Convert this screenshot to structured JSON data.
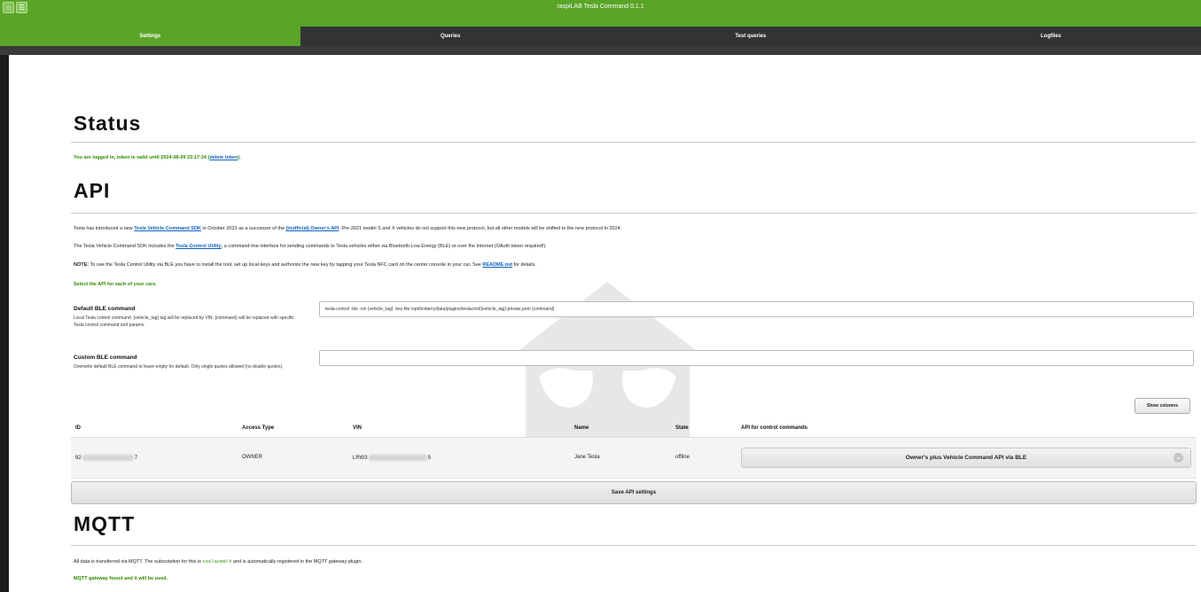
{
  "app": {
    "title": "raspiLAB Tesla Command 0.1.1",
    "home_icon": "⌂",
    "menu_icon": "☰"
  },
  "tabs": [
    {
      "label": "Settings",
      "active": true
    },
    {
      "label": "Queries",
      "active": false
    },
    {
      "label": "Test queries",
      "active": false
    },
    {
      "label": "Logfiles",
      "active": false
    }
  ],
  "status": {
    "heading": "Status",
    "message_prefix": "You are logged in, token is valid until 2024-08-09 23:17:24 (",
    "delete_link": "delete token",
    "message_suffix": ")."
  },
  "api": {
    "heading": "API",
    "p1_a": "Tesla has introduced a new ",
    "p1_link1": "Tesla Vehicle Command SDK",
    "p1_b": " in October 2023 as a successor of the ",
    "p1_link2": "(inofficial) Owner's API",
    "p1_c": ". Pre-2021 model S and X vehicles do not support this new protocol, but all other models will be shifted to the new protocol in 2024.",
    "p2_a": "The Tesla Vehicle Command SDK includes the ",
    "p2_link": "Tesla Control Utility",
    "p2_b": ", a command-line interface for sending commands to Tesla vehicles either via Bluetooth Low Energy (BLE) or over the Internet (OAuth token required!).",
    "p3_note": "NOTE:",
    "p3_a": " To use the Tesla Control Utility via BLE you have to install the tool, set up local keys and authorize the new key by tapping your Tesla NFC card on the center console in your car. See ",
    "p3_link": "README.md",
    "p3_b": " for details.",
    "select_prompt": "Select the API for each of your cars.",
    "default_ble": {
      "label": "Default BLE command",
      "desc": "Local Tesla control command. {vehicle_tag} tag will be replaced by VIN. {command} will be replaced with specific Tesla control command and params.",
      "value": "tesla-control -ble -vin {vehicle_tag} -key-file /opt/loxberry/data/plugins/teslacmd/{vehicle_tag}-private.pem {command}"
    },
    "custom_ble": {
      "label": "Custom BLE command",
      "desc": "Overwrite default BLE command or leave empty for default. Only single quotes allowed (no double quotes).",
      "value": ""
    },
    "show_columns": "Show columns",
    "table": {
      "headers": [
        "ID",
        "Access Type",
        "VIN",
        "Name",
        "State",
        "API for control commands"
      ],
      "row": {
        "id_start": "92",
        "id_end": "7",
        "access_type": "OWNER",
        "vin_start": "LRW3",
        "vin_end": "5",
        "name": "Jane Tesla",
        "state": "offline",
        "api": "Owner's plus Vehicle Command API via BLE"
      }
    },
    "save_button": "Save API settings"
  },
  "mqtt": {
    "heading": "MQTT",
    "p_a": "All data is transferred via MQTT. The subscription for this is ",
    "p_code": "teslacmd/#",
    "p_b": " and is automatically registered in the MQTT gateway plugin.",
    "gateway_status": "MQTT gateway found and it will be used."
  }
}
